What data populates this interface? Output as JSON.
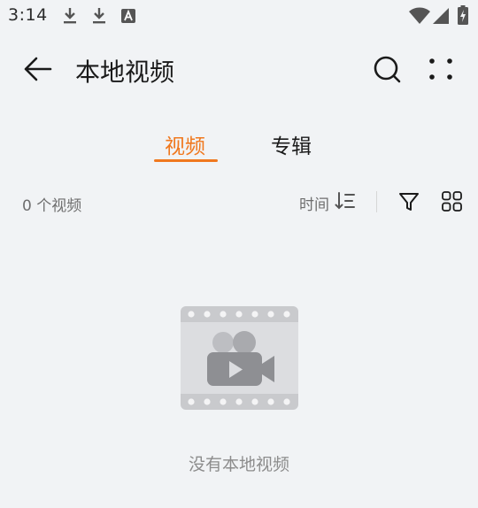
{
  "status_bar": {
    "time": "3:14",
    "left_icons": [
      "download-icon",
      "download-icon",
      "font-a-icon"
    ],
    "right_icons": [
      "wifi-icon",
      "cellular-signal-icon",
      "battery-icon"
    ]
  },
  "header": {
    "title": "本地视频",
    "back_icon": "arrow-left-icon",
    "search_icon": "search-icon",
    "more_icon": "more-dots-icon"
  },
  "tabs": [
    {
      "label": "视频",
      "active": true
    },
    {
      "label": "专辑",
      "active": false
    }
  ],
  "toolbar": {
    "count_text": "0 个视频",
    "sort_label": "时间",
    "sort_icon": "sort-descending-icon",
    "filter_icon": "filter-icon",
    "view_icon": "grid-view-icon"
  },
  "empty_state": {
    "message": "没有本地视频",
    "icon": "video-film-icon"
  },
  "colors": {
    "accent": "#f0781e",
    "background": "#f1f3f5",
    "text_primary": "#1a1a1a",
    "text_secondary": "#6e6e6e"
  }
}
